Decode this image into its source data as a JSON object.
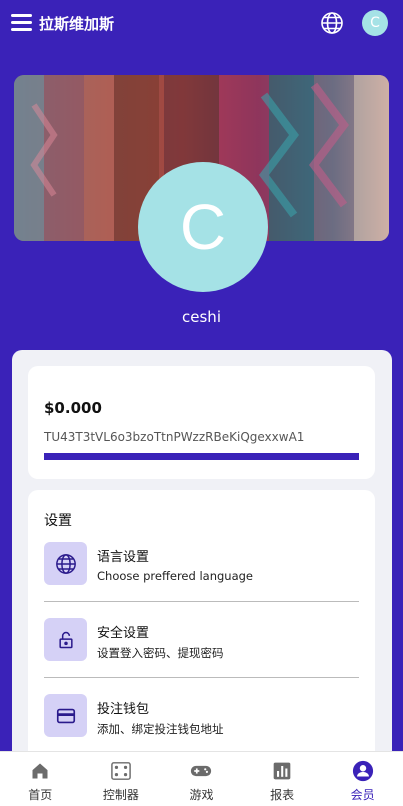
{
  "header": {
    "title": "拉斯维加斯",
    "avatar_letter": "C"
  },
  "profile": {
    "avatar_letter": "C",
    "username": "ceshi"
  },
  "wallet": {
    "balance": "$0.000",
    "address": "TU43T3tVL6o3bzoTtnPWzzRBeKiQgexxwA1",
    "progress": 1.0
  },
  "settings": {
    "title": "设置",
    "items": [
      {
        "icon": "globe-icon",
        "title": "语言设置",
        "desc": "Choose preffered language"
      },
      {
        "icon": "lock-icon",
        "title": "安全设置",
        "desc": "设置登入密码、提现密码"
      },
      {
        "icon": "credit-card-icon",
        "title": "投注钱包",
        "desc": "添加、绑定投注钱包地址"
      }
    ]
  },
  "nav": {
    "items": [
      {
        "icon": "home-icon",
        "label": "首页"
      },
      {
        "icon": "controller-icon",
        "label": "控制器"
      },
      {
        "icon": "gamepad-icon",
        "label": "游戏"
      },
      {
        "icon": "report-icon",
        "label": "报表"
      },
      {
        "icon": "member-icon",
        "label": "会员"
      }
    ],
    "active_index": 4
  },
  "colors": {
    "brand": "#3a22b8",
    "avatar": "#a5e2e6",
    "icon_bg": "#d5d1f6",
    "panel_bg": "#f0f1f6"
  }
}
